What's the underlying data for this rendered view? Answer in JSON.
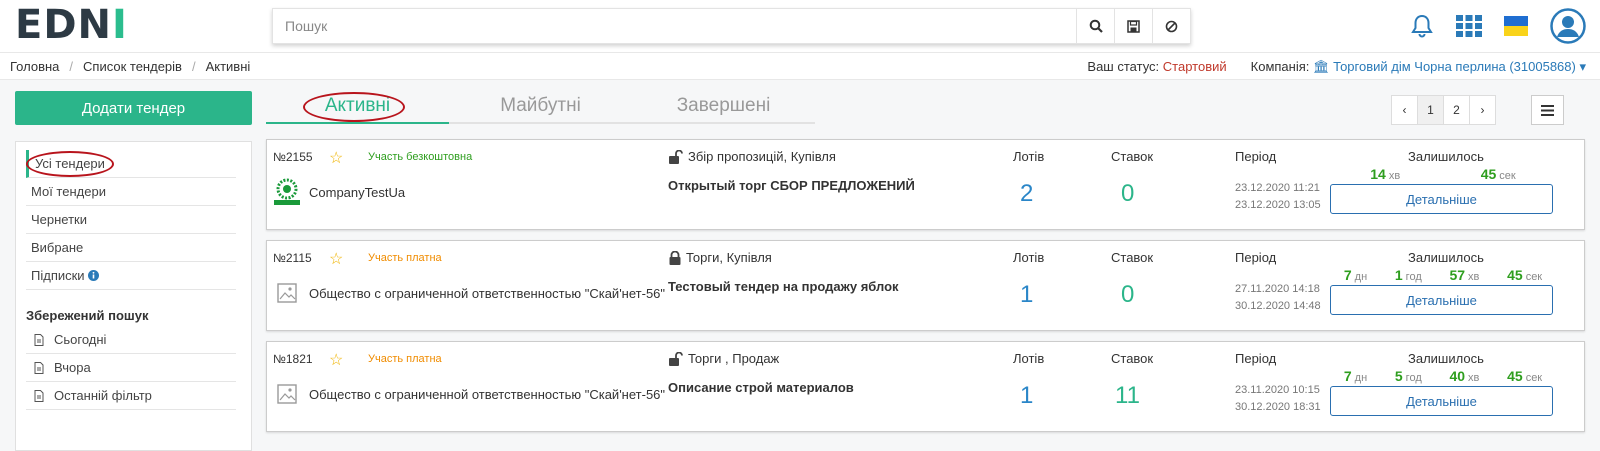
{
  "brand": {
    "logo_a": "ED",
    "logo_b": "N",
    "logo_c": "I"
  },
  "search": {
    "placeholder": "Пошук"
  },
  "breadcrumb": [
    "Головна",
    "Список тендерів",
    "Активні"
  ],
  "status": {
    "label": "Ваш статус:",
    "value": "Стартовий",
    "company_label": "Компанія:",
    "company_value": "Торговий дім Чорна перлина (31005868)"
  },
  "add_button": "Додати тендер",
  "sidebar": {
    "items": [
      "Усі тендери",
      "Мої тендери",
      "Чернетки",
      "Вибране",
      "Підписки"
    ],
    "saved_title": "Збережений пошук",
    "saved": [
      "Сьогодні",
      "Вчора",
      "Останній фільтр"
    ]
  },
  "tabs": [
    "Активні",
    "Майбутні",
    "Завершені"
  ],
  "pager": {
    "prev": "‹",
    "pages": [
      "1",
      "2"
    ],
    "next": "›",
    "current": "1"
  },
  "labels": {
    "lots": "Лотів",
    "bids": "Ставок",
    "period": "Період",
    "remaining": "Залишилось",
    "details": "Детальніше"
  },
  "units": {
    "days": "дн",
    "hours": "год",
    "minutes": "хв",
    "seconds": "сек"
  },
  "tenders": [
    {
      "number": "№2155",
      "participation": "Участь безкоштовна",
      "participation_color": "#2e9e1e",
      "org": "CompanyTestUa",
      "type": "Збір пропозицій, Купівля",
      "title": "Открытый торг СБОР ПРЕДЛОЖЕНИЙ",
      "lots": "2",
      "bids": "0",
      "period_start": "23.12.2020 11:21",
      "period_end": "23.12.2020 13:05",
      "remaining": {
        "minutes": "14",
        "seconds": "45"
      }
    },
    {
      "number": "№2115",
      "participation": "Участь платна",
      "participation_color": "#f08c00",
      "org": "Общество с ограниченной ответственностью \"Скай'нет-56\"",
      "type": "Торги, Купівля",
      "title": "Тестовый тендер на продажу яблок",
      "lots": "1",
      "bids": "0",
      "period_start": "27.11.2020 14:18",
      "period_end": "30.12.2020 14:48",
      "remaining": {
        "days": "7",
        "hours": "1",
        "minutes": "57",
        "seconds": "45"
      }
    },
    {
      "number": "№1821",
      "participation": "Участь платна",
      "participation_color": "#f08c00",
      "org": "Общество с ограниченной ответственностью \"Скай'нет-56\"",
      "type": "Торги , Продаж",
      "title": "Описание строй материалов",
      "lots": "1",
      "bids": "11",
      "period_start": "23.11.2020 10:15",
      "period_end": "30.12.2020 18:31",
      "remaining": {
        "days": "7",
        "hours": "5",
        "minutes": "40",
        "seconds": "45"
      }
    }
  ],
  "colors": {
    "accent": "#2bb58a",
    "link": "#2a7ab8",
    "highlight_ring": "#b8141c"
  }
}
